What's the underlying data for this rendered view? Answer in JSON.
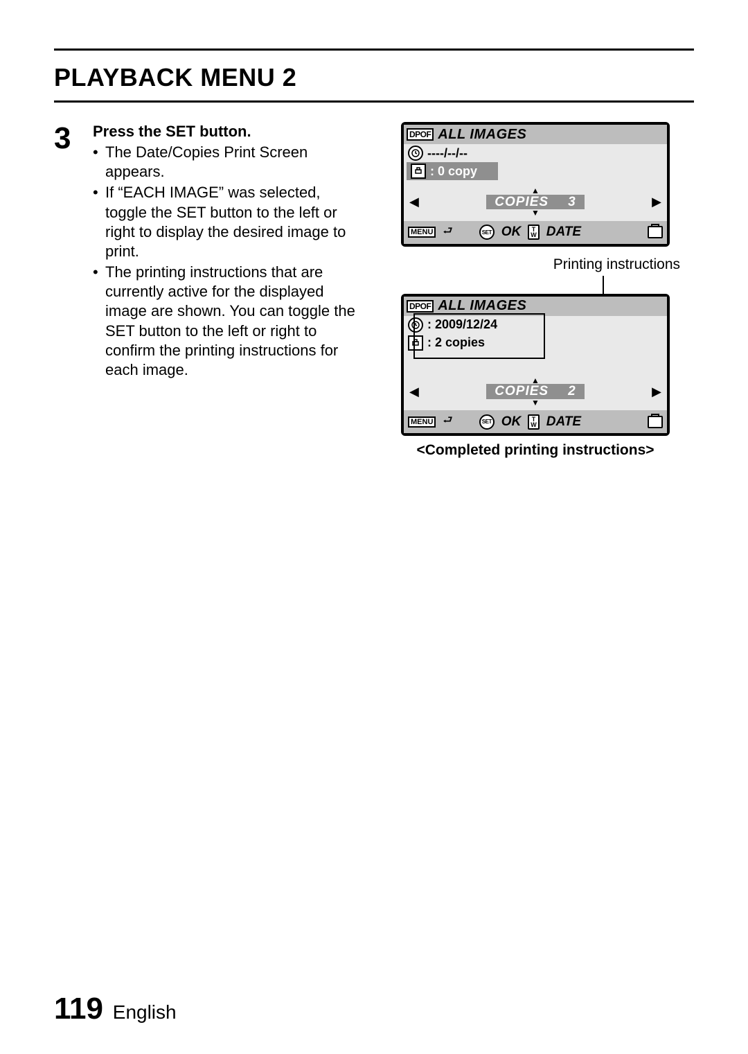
{
  "page": {
    "title": "PLAYBACK MENU 2",
    "number": "119",
    "language": "English"
  },
  "step": {
    "number": "3",
    "heading": "Press the SET button.",
    "bullets": [
      "The Date/Copies Print Screen appears.",
      "If “EACH IMAGE” was selected, toggle the SET button to the left or right to display the desired image to print.",
      "The printing instructions that are currently active for the displayed image are shown. You can toggle the SET button to the left or right to confirm the printing instructions for each image."
    ]
  },
  "lcd1": {
    "dpof_badge": "DPOF",
    "header": "ALL IMAGES",
    "date": "----/--/--",
    "copies_info": ": 0  copy",
    "copies_label": "COPIES",
    "copies_value": "3",
    "menu": "MENU",
    "ok": "OK",
    "date_btn": "DATE",
    "set": "SET",
    "tw_t": "T",
    "tw_w": "W"
  },
  "callout": "Printing instructions",
  "lcd2": {
    "dpof_badge": "DPOF",
    "header": "ALL IMAGES",
    "date": ": 2009/12/24",
    "copies_info": ": 2 copies",
    "copies_label": "COPIES",
    "copies_value": "2",
    "menu": "MENU",
    "ok": "OK",
    "date_btn": "DATE",
    "set": "SET",
    "tw_t": "T",
    "tw_w": "W"
  },
  "completed_caption": "<Completed printing instructions>"
}
